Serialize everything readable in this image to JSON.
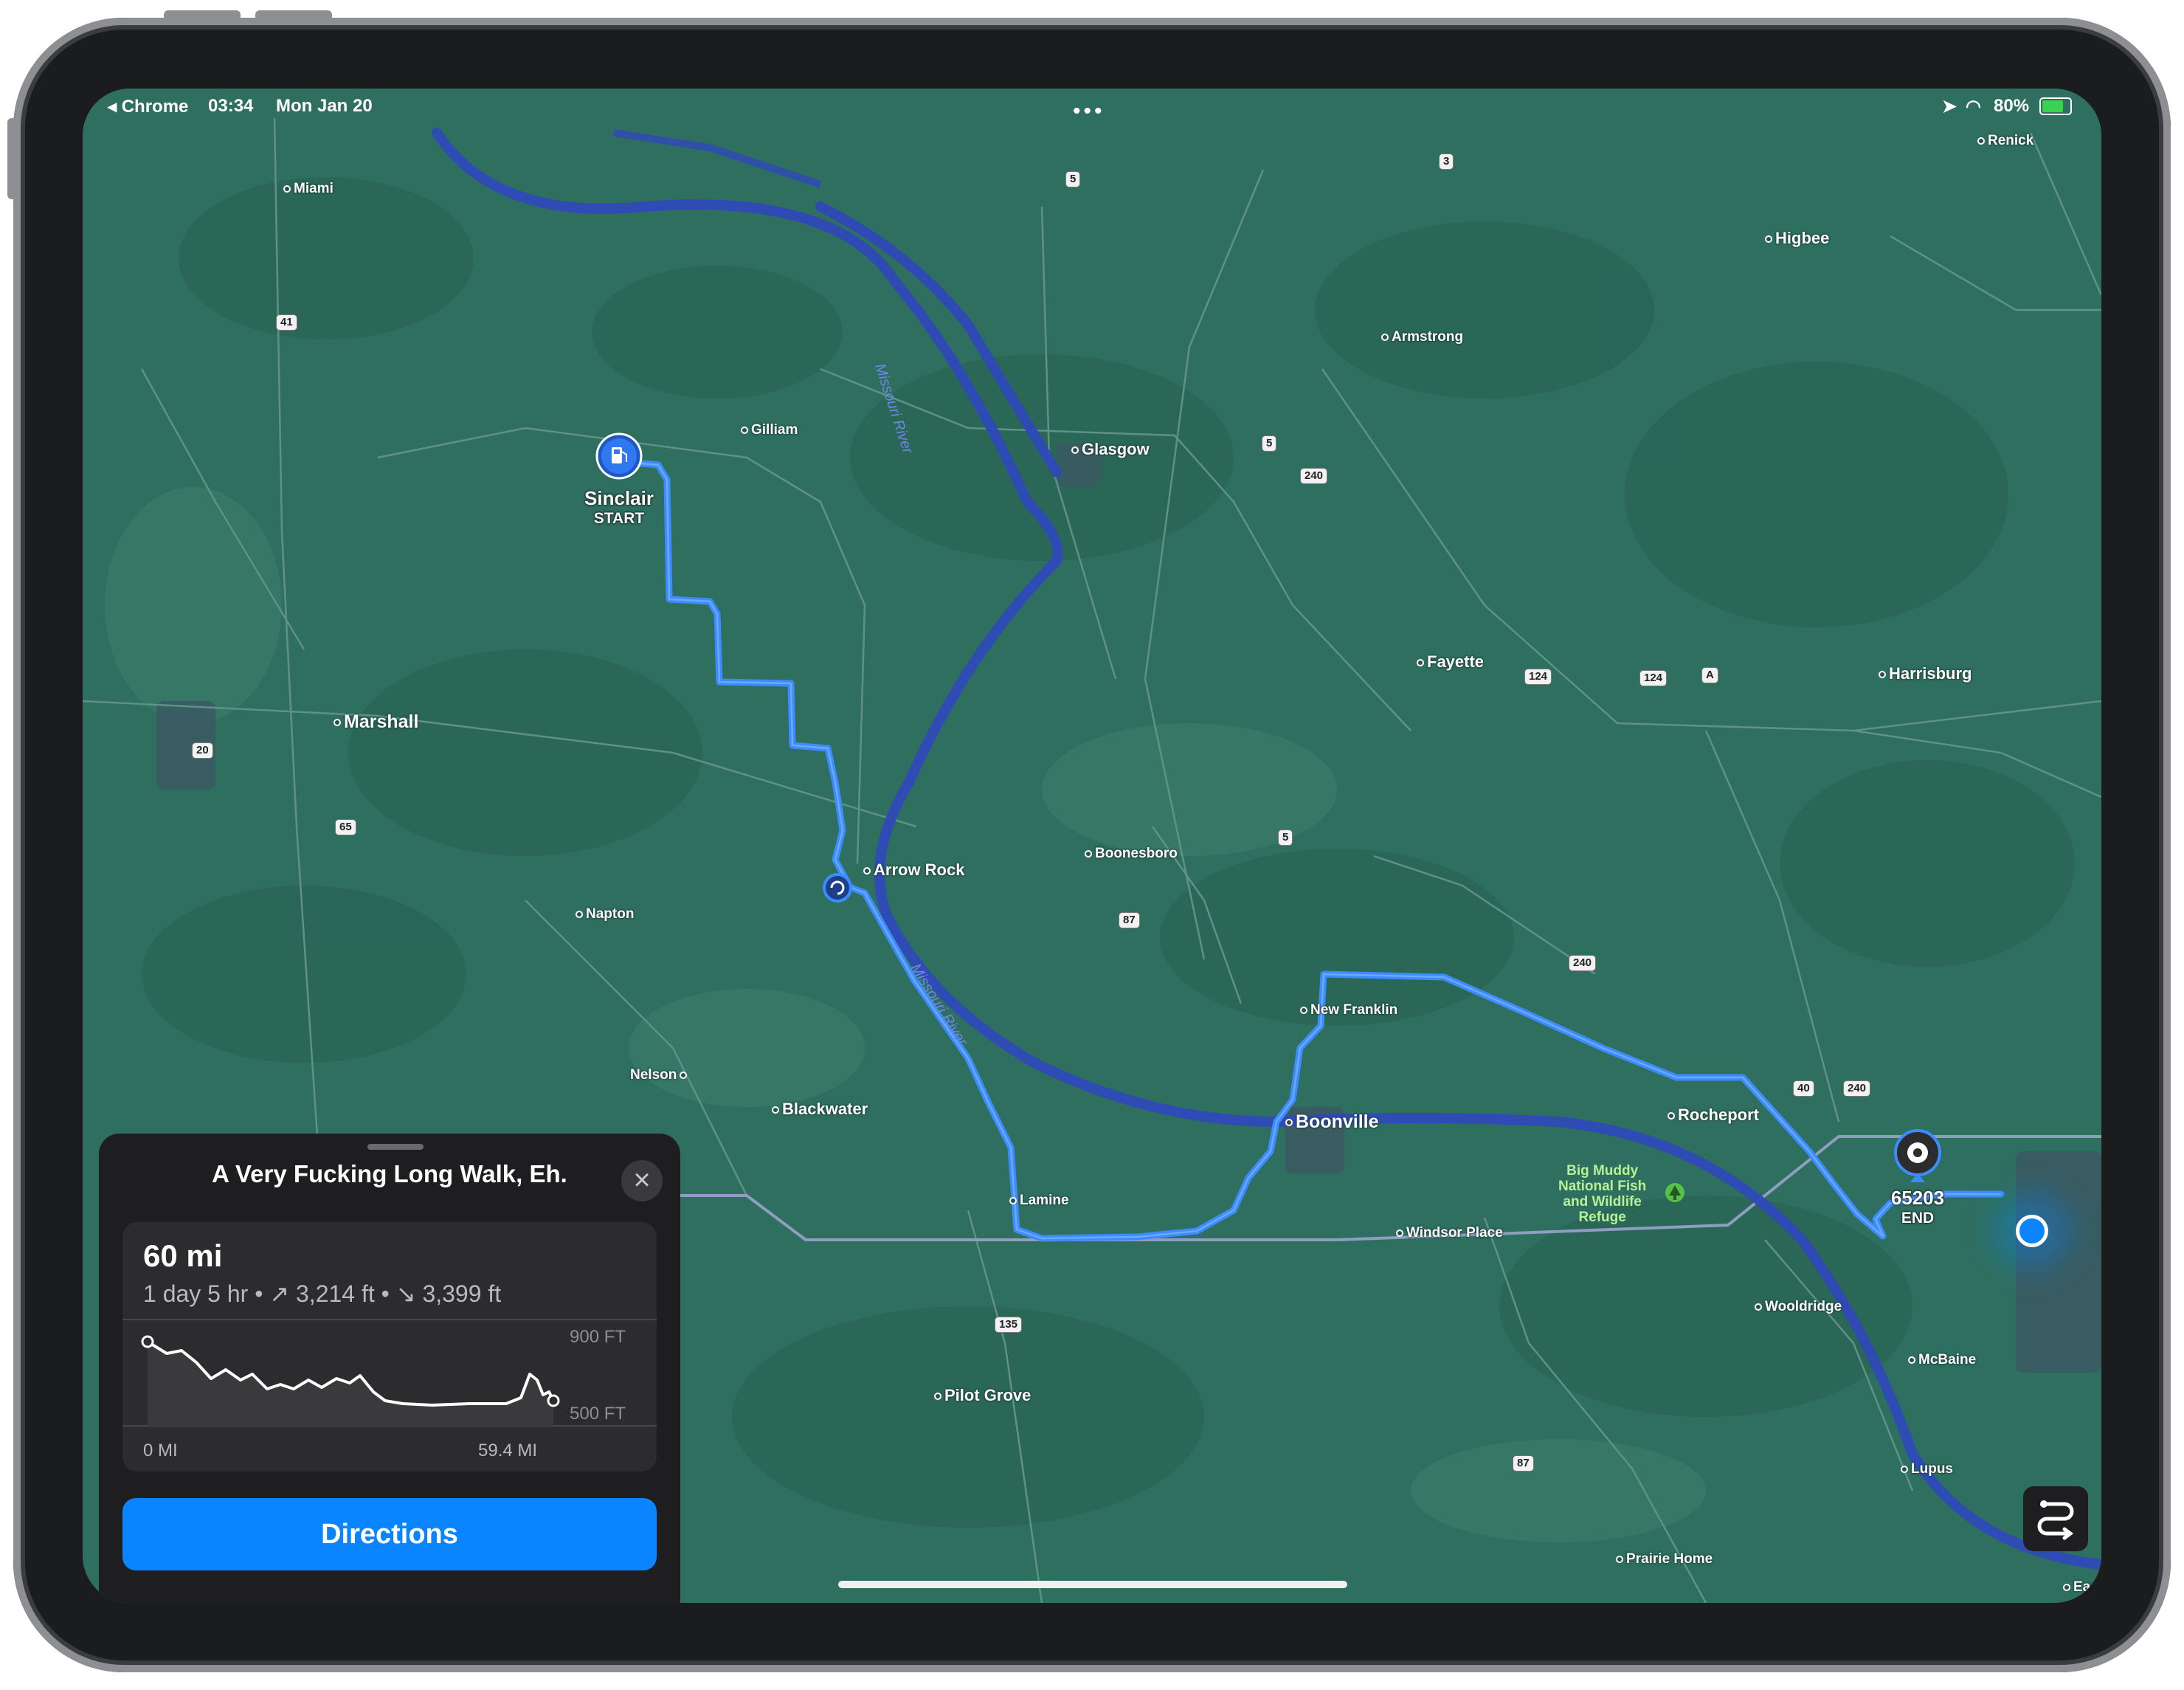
{
  "status_bar": {
    "back_app": "◂ Chrome",
    "time": "03:34",
    "date": "Mon Jan 20",
    "battery": "80%"
  },
  "map": {
    "places": [
      {
        "name": "Miami",
        "size": "small"
      },
      {
        "name": "Gilliam",
        "size": "small"
      },
      {
        "name": "Glasgow",
        "size": "normal"
      },
      {
        "name": "Armstrong",
        "size": "small"
      },
      {
        "name": "Higbee",
        "size": "normal"
      },
      {
        "name": "Renick",
        "size": "small"
      },
      {
        "name": "Marshall",
        "size": "big"
      },
      {
        "name": "Fayette",
        "size": "normal"
      },
      {
        "name": "Harrisburg",
        "size": "normal"
      },
      {
        "name": "Arrow Rock",
        "size": "normal"
      },
      {
        "name": "Boonesboro",
        "size": "small"
      },
      {
        "name": "Napton",
        "size": "small"
      },
      {
        "name": "New Franklin",
        "size": "small"
      },
      {
        "name": "Nelson",
        "size": "small"
      },
      {
        "name": "Blackwater",
        "size": "normal"
      },
      {
        "name": "Boonville",
        "size": "big"
      },
      {
        "name": "Rocheport",
        "size": "normal"
      },
      {
        "name": "Lamine",
        "size": "small"
      },
      {
        "name": "Windsor Place",
        "size": "small"
      },
      {
        "name": "Wooldridge",
        "size": "small"
      },
      {
        "name": "McBaine",
        "size": "small"
      },
      {
        "name": "Pilot Grove",
        "size": "normal"
      },
      {
        "name": "Lupus",
        "size": "small"
      },
      {
        "name": "Prairie Home",
        "size": "small"
      },
      {
        "name": "Eas",
        "size": "small"
      }
    ],
    "shields": [
      "5",
      "3",
      "41",
      "5",
      "240",
      "124",
      "124",
      "A",
      "20",
      "65",
      "5",
      "87",
      "240",
      "40",
      "240",
      "135",
      "87"
    ],
    "rivers": [
      "Missouri River",
      "Missouri River"
    ],
    "refuge": [
      "Big Muddy",
      "National Fish",
      "and Wildlife",
      "Refuge"
    ],
    "start": {
      "name": "Sinclair",
      "tag": "START",
      "icon": "fuel-pump-icon"
    },
    "end": {
      "name": "65203",
      "tag": "END",
      "icon": "pin-icon"
    }
  },
  "panel": {
    "title": "A Very Fucking Long Walk, Eh.",
    "close_icon": "close-icon",
    "distance": "60 mi",
    "duration": "1 day 5 hr",
    "ascent": "3,214 ft",
    "descent": "3,399 ft",
    "elevation_top": "900 FT",
    "elevation_bottom": "500 FT",
    "x_start": "0 MI",
    "x_end": "59.4 MI",
    "directions_label": "Directions"
  },
  "colors": {
    "route": "#3d8cff",
    "map_base": "#2f6f60",
    "accent": "#0a84ff"
  }
}
